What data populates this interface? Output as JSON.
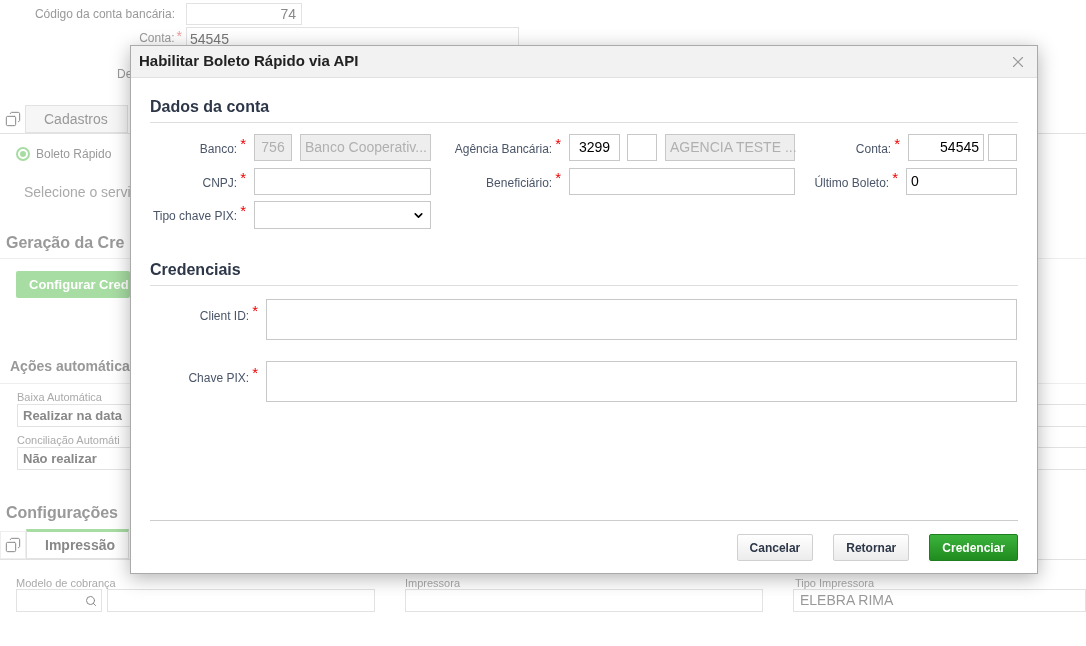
{
  "background": {
    "top_fields": [
      {
        "label": "Código da conta bancária:",
        "value": "74"
      },
      {
        "label": "Conta:",
        "required_mark": "*",
        "value": "54545"
      },
      {
        "label": "De"
      }
    ],
    "tabs": [
      {
        "label": "Cadastros",
        "selected": false
      }
    ],
    "radio": {
      "label": "Boleto Rápido",
      "selected": true
    },
    "service_prompt": "Selecione o servi",
    "credential_section": {
      "title": "Geração da Cre",
      "button": "Configurar Cred"
    },
    "auto_section": {
      "title": "Ações automática",
      "fields": [
        {
          "label": "Baixa Automática",
          "value": "Realizar na data"
        },
        {
          "label": "Conciliação Automáti",
          "value": "Não realizar"
        }
      ]
    },
    "config_section": {
      "title": "Configurações",
      "tabs": [
        {
          "label": "Impressão",
          "selected": true
        }
      ],
      "fields": [
        {
          "label": "Modelo de cobrança",
          "kind": "lookup"
        },
        {
          "label": "Impressora",
          "kind": "text"
        },
        {
          "label": "Tipo Impressora",
          "kind": "text",
          "value": "ELEBRA RIMA"
        }
      ]
    }
  },
  "dialog": {
    "title": "Habilitar Boleto Rápido via API",
    "account_section": {
      "title": "Dados da conta",
      "bank": {
        "label": "Banco:",
        "required_mark": "*",
        "code": "756",
        "name": "Banco Cooperativ..."
      },
      "agency": {
        "label": "Agência Bancária:",
        "required_mark": "*",
        "number": "3299",
        "name": "AGENCIA TESTE ..."
      },
      "account": {
        "label": "Conta:",
        "required_mark": "*",
        "number": "54545"
      },
      "cnpj": {
        "label": "CNPJ:",
        "required_mark": "*"
      },
      "beneficiary": {
        "label": "Beneficiário:",
        "required_mark": "*"
      },
      "last_boleto": {
        "label": "Último Boleto:",
        "required_mark": "*",
        "value": "0"
      },
      "pix_type": {
        "label": "Tipo chave PIX:",
        "required_mark": "*"
      }
    },
    "credentials_section": {
      "title": "Credenciais",
      "fields": [
        {
          "label": "Client ID:",
          "required_mark": "*"
        },
        {
          "label": "Chave PIX:",
          "required_mark": "*"
        }
      ]
    },
    "buttons": [
      {
        "label": "Cancelar",
        "kind": "secondary"
      },
      {
        "label": "Retornar",
        "kind": "secondary"
      },
      {
        "label": "Credenciar",
        "kind": "primary"
      }
    ]
  }
}
